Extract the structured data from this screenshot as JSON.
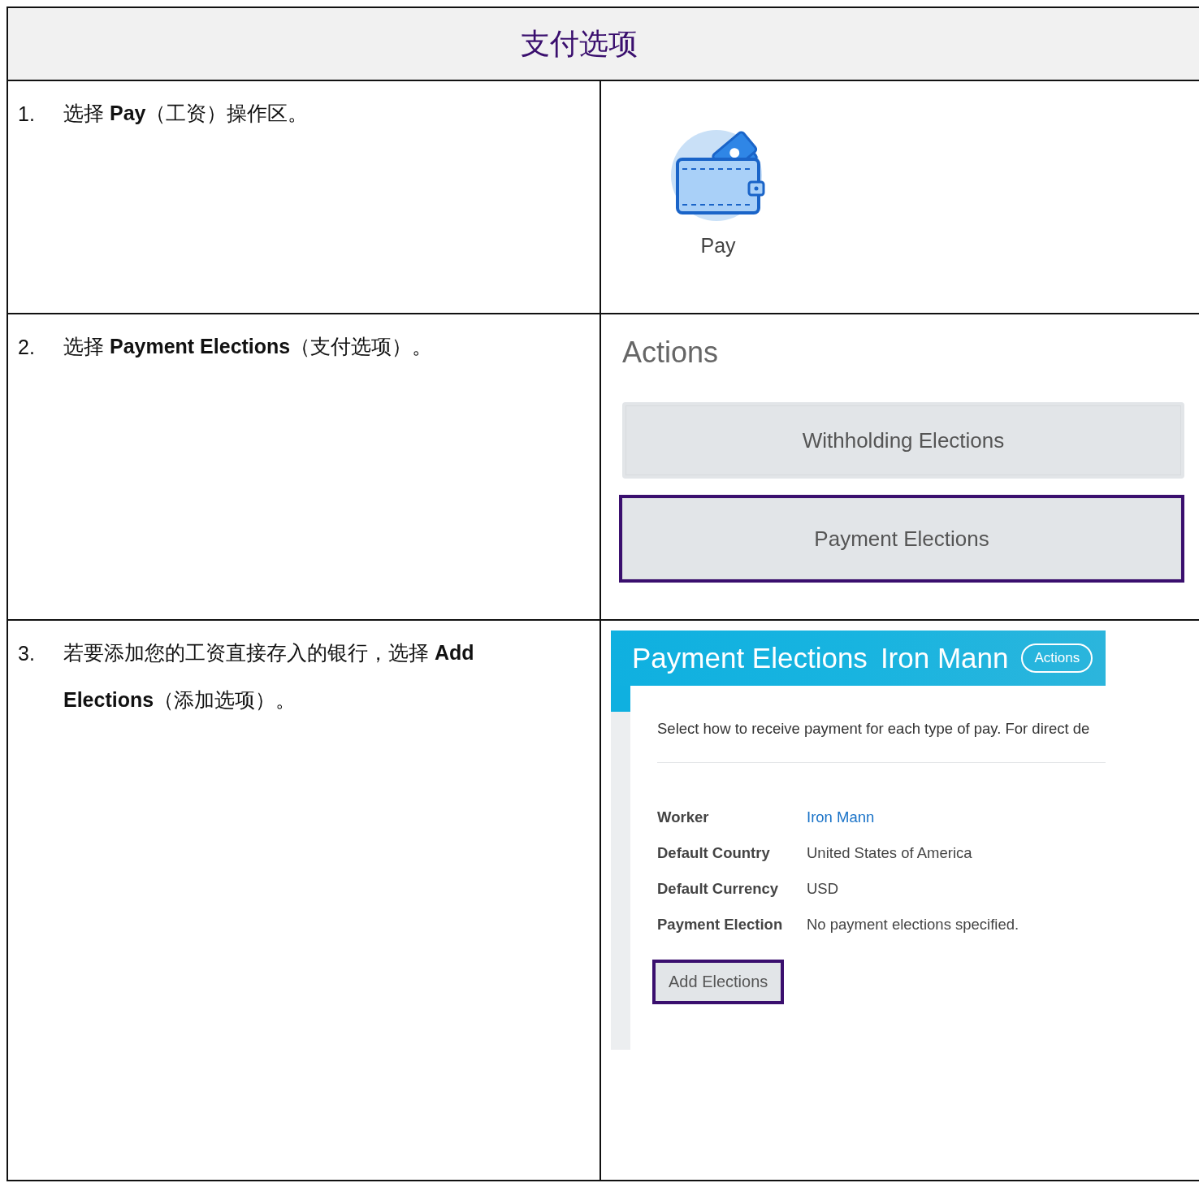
{
  "title": "支付选项",
  "steps": [
    {
      "number": "1.",
      "text": "选择 **Pay**（工资）操作区。",
      "panel": {
        "kind": "pay_tile",
        "label": "Pay"
      }
    },
    {
      "number": "2.",
      "text": "选择 **Payment Elections**（支付选项）。",
      "panel": {
        "kind": "actions",
        "heading": "Actions",
        "buttons": [
          {
            "label": "Withholding Elections",
            "highlighted": false
          },
          {
            "label": "Payment Elections",
            "highlighted": true
          }
        ]
      }
    },
    {
      "number": "3.",
      "text": "若要添加您的工资直接存入的银行，选择 **Add Elections**（添加选项）。",
      "panel": {
        "kind": "elections",
        "title": "Payment Elections",
        "worker_name": "Iron Mann",
        "actions_button": "Actions",
        "intro": "Select how to receive payment for each type of pay. For direct de",
        "fields": [
          {
            "label": "Worker",
            "value": "Iron Mann",
            "kind": "link"
          },
          {
            "label": "Default Country",
            "value": "United States of America",
            "kind": "text"
          },
          {
            "label": "Default Currency",
            "value": "USD",
            "kind": "text"
          },
          {
            "label": "Payment Election",
            "value": "No payment elections specified.",
            "kind": "text"
          }
        ],
        "add_button": {
          "label": "Add Elections",
          "highlighted": true
        }
      }
    }
  ]
}
